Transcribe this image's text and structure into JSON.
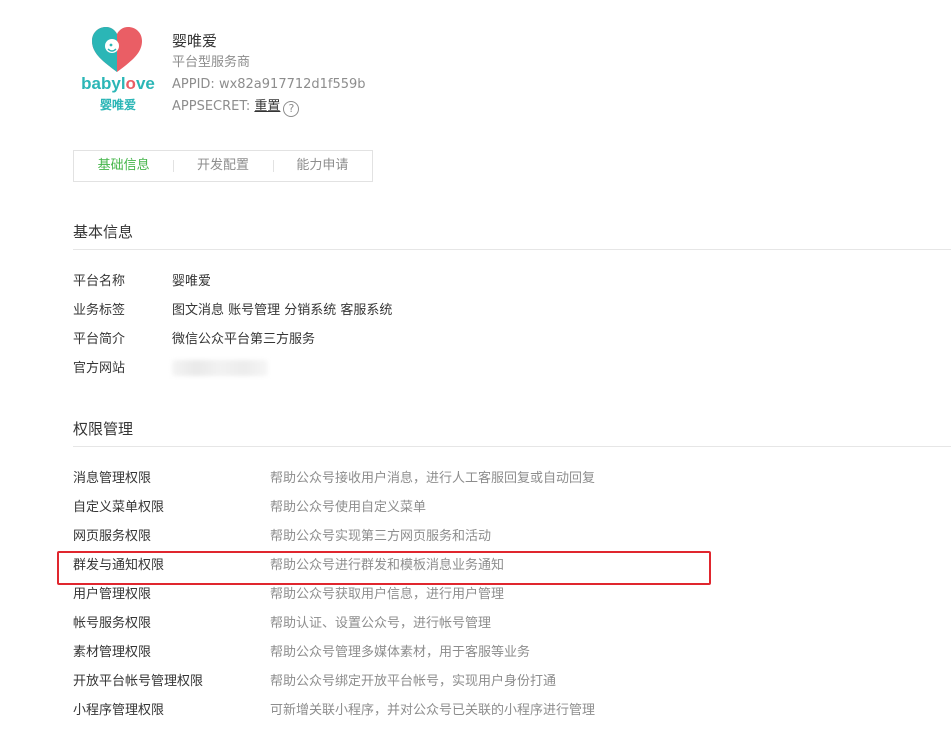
{
  "brand": {
    "logo_text_main": "babyl",
    "logo_text_o": "o",
    "logo_text_end": "ve",
    "logo_text_cn": "婴唯爱",
    "color_teal": "#2bb6b6",
    "color_coral": "#ea5e65"
  },
  "account": {
    "name": "婴唯爱",
    "type": "平台型服务商",
    "appid_label": "APPID: ",
    "appid": "wx82a917712d1f559b",
    "secret_label": "APPSECRET: ",
    "secret_action": "重置",
    "help_glyph": "?"
  },
  "tabs": [
    {
      "label": "基础信息",
      "active": true
    },
    {
      "label": "开发配置",
      "active": false
    },
    {
      "label": "能力申请",
      "active": false
    }
  ],
  "basic_info": {
    "title": "基本信息",
    "rows": [
      {
        "key": "平台名称",
        "value": "婴唯爱"
      },
      {
        "key": "业务标签",
        "value": "图文消息 账号管理 分销系统 客服系统"
      },
      {
        "key": "平台简介",
        "value": "微信公众平台第三方服务"
      },
      {
        "key": "官方网站",
        "value": ""
      }
    ]
  },
  "permissions": {
    "title": "权限管理",
    "rows": [
      {
        "key": "消息管理权限",
        "value": "帮助公众号接收用户消息，进行人工客服回复或自动回复"
      },
      {
        "key": "自定义菜单权限",
        "value": "帮助公众号使用自定义菜单"
      },
      {
        "key": "网页服务权限",
        "value": "帮助公众号实现第三方网页服务和活动"
      },
      {
        "key": "群发与通知权限",
        "value": "帮助公众号进行群发和模板消息业务通知"
      },
      {
        "key": "用户管理权限",
        "value": "帮助公众号获取用户信息，进行用户管理"
      },
      {
        "key": "帐号服务权限",
        "value": "帮助认证、设置公众号，进行帐号管理"
      },
      {
        "key": "素材管理权限",
        "value": "帮助公众号管理多媒体素材，用于客服等业务"
      },
      {
        "key": "开放平台帐号管理权限",
        "value": "帮助公众号绑定开放平台帐号，实现用户身份打通"
      },
      {
        "key": "小程序管理权限",
        "value": "可新增关联小程序，并对公众号已关联的小程序进行管理"
      }
    ]
  },
  "accent": {
    "active_tab": "#44b549",
    "highlight": "#e0262e"
  }
}
